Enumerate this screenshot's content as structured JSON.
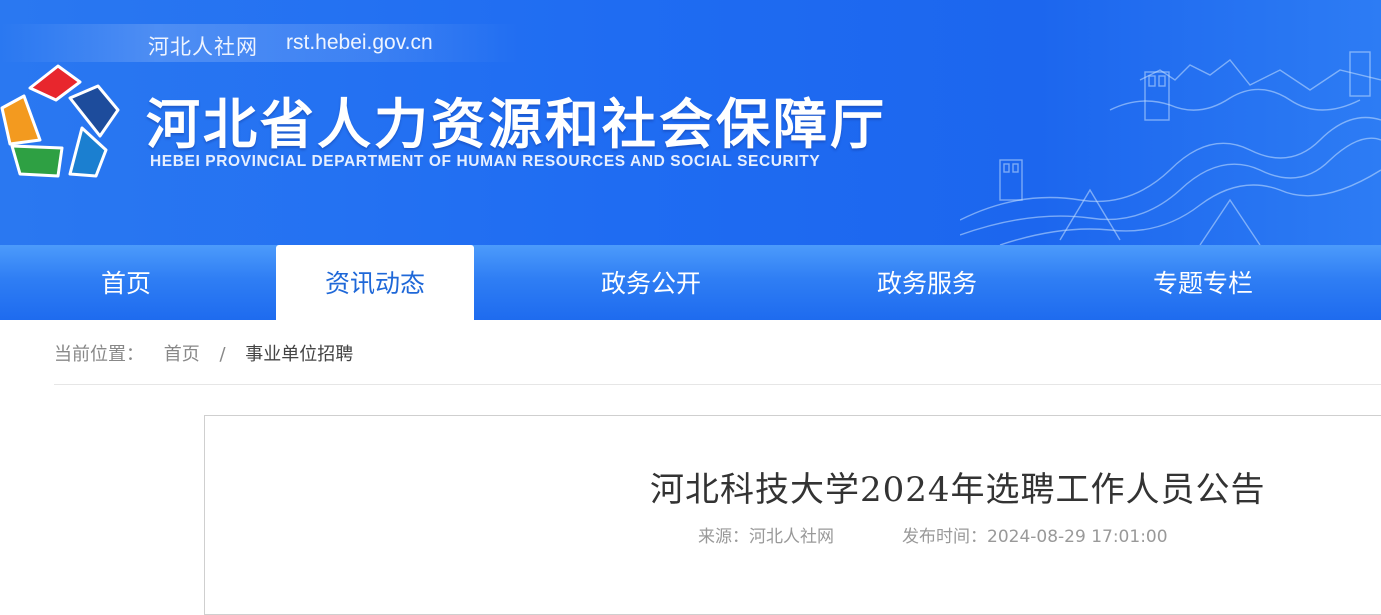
{
  "header": {
    "site_name": "河北人社网",
    "site_url": "rst.hebei.gov.cn",
    "org_title": "河北省人力资源和社会保障厅",
    "org_subtitle": "HEBEI PROVINCIAL DEPARTMENT OF HUMAN RESOURCES AND SOCIAL SECURITY",
    "logo_icon": "provincial-pentagon-logo",
    "decoration": "great-wall-illustration",
    "colors": {
      "banner": "#1f6cf2",
      "nav": "#2f7ef4",
      "active_tab_text": "#1f68d8"
    }
  },
  "nav": {
    "items": [
      {
        "label": "首页",
        "active": false
      },
      {
        "label": "资讯动态",
        "active": true
      },
      {
        "label": "政务公开",
        "active": false
      },
      {
        "label": "政务服务",
        "active": false
      },
      {
        "label": "专题专栏",
        "active": false
      }
    ]
  },
  "breadcrumb": {
    "prefix": "当前位置：",
    "home": "首页",
    "separator": "/",
    "current": "事业单位招聘"
  },
  "article": {
    "title": "河北科技大学2024年选聘工作人员公告",
    "source_label": "来源：河北人社网",
    "publish_label": "发布时间：2024-08-29 17:01:00"
  }
}
